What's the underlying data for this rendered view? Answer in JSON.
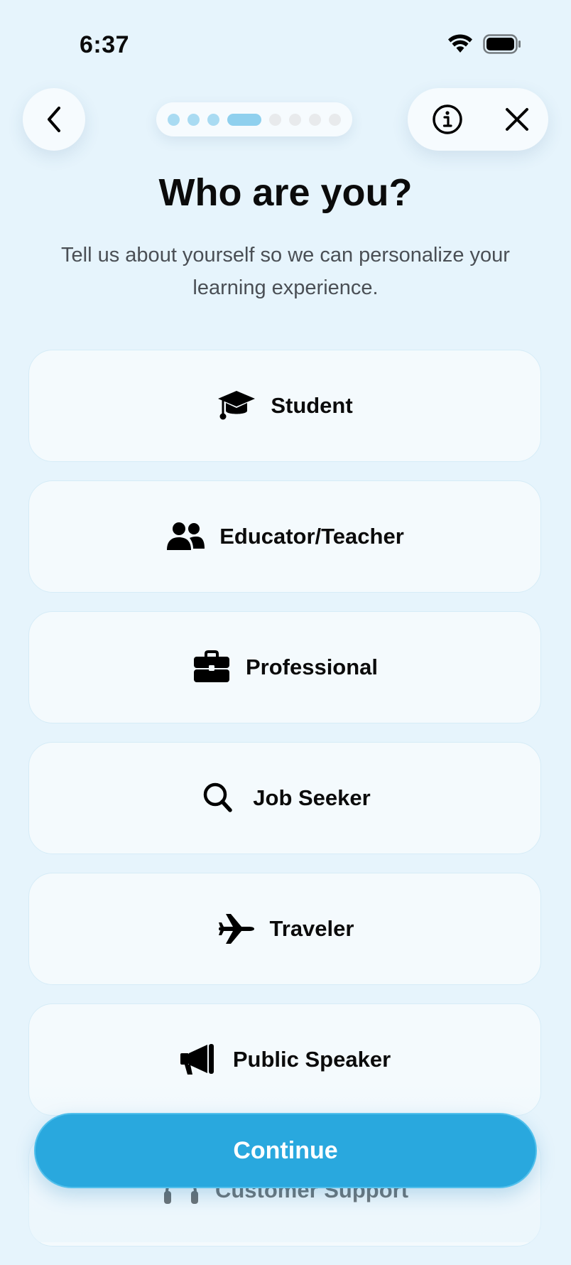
{
  "status_bar": {
    "time": "6:37"
  },
  "progress": {
    "total_steps": 8,
    "current_step": 4
  },
  "header": {
    "title": "Who are you?",
    "subtitle": "Tell us about yourself so we can personalize your learning experience."
  },
  "options": [
    {
      "label": "Student",
      "icon": "graduation-cap-icon"
    },
    {
      "label": "Educator/Teacher",
      "icon": "users-icon"
    },
    {
      "label": "Professional",
      "icon": "briefcase-icon"
    },
    {
      "label": "Job Seeker",
      "icon": "search-icon"
    },
    {
      "label": "Traveler",
      "icon": "airplane-icon"
    },
    {
      "label": "Public Speaker",
      "icon": "megaphone-icon"
    },
    {
      "label": "Customer Support",
      "icon": "headset-icon"
    }
  ],
  "footer": {
    "continue_label": "Continue"
  },
  "colors": {
    "background": "#e6f4fc",
    "accent": "#29a8de",
    "card": "#f4fafd"
  }
}
